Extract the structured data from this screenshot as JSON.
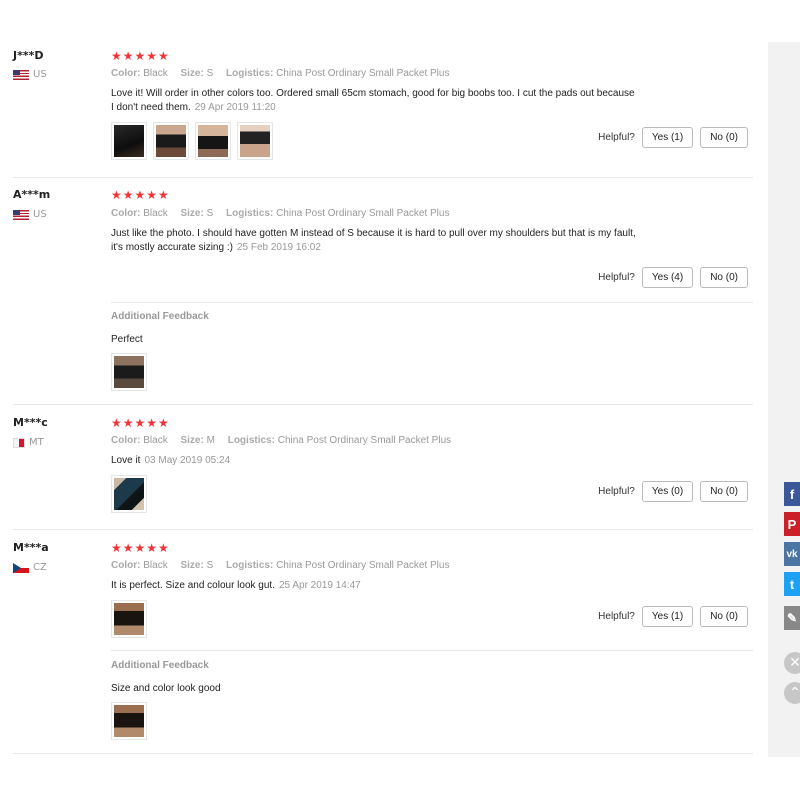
{
  "labels": {
    "color": "Color:",
    "size": "Size:",
    "logistics": "Logistics:",
    "helpful": "Helpful?",
    "additional_feedback": "Additional Feedback"
  },
  "reviews": [
    {
      "user": "J***D",
      "country": "US",
      "stars": "★★★★★",
      "color": "Black",
      "size": "S",
      "logistics": "China Post Ordinary Small Packet Plus",
      "text_line1": "Love it! Will order in other colors too. Ordered small 65cm stomach, good for big boobs too. I cut the pads out because",
      "text_line2": "I don't need them.",
      "date": "29 Apr 2019 11:20",
      "yes": "Yes (1)",
      "no": "No (0)"
    },
    {
      "user": "A***m",
      "country": "US",
      "stars": "★★★★★",
      "color": "Black",
      "size": "S",
      "logistics": "China Post Ordinary Small Packet Plus",
      "text_line1": "Just like the photo. I should have gotten M instead of S because it is hard to pull over my shoulders but that is my fault,",
      "text_line2": "it's mostly accurate sizing :)",
      "date": "25 Feb 2019 16:02",
      "yes": "Yes (4)",
      "no": "No (0)",
      "additional": "Perfect"
    },
    {
      "user": "M***c",
      "country": "MT",
      "stars": "★★★★★",
      "color": "Black",
      "size": "M",
      "logistics": "China Post Ordinary Small Packet Plus",
      "text_line1": "Love it",
      "date": "03 May 2019 05:24",
      "yes": "Yes (0)",
      "no": "No (0)"
    },
    {
      "user": "M***a",
      "country": "CZ",
      "stars": "★★★★★",
      "color": "Black",
      "size": "S",
      "logistics": "China Post Ordinary Small Packet Plus",
      "text_line1": "It is perfect. Size and colour look gut.",
      "date": "25 Apr 2019 14:47",
      "yes": "Yes (1)",
      "no": "No (0)",
      "additional": "Size and color look good"
    }
  ],
  "social": {
    "facebook": "f",
    "pinterest": "P",
    "vk": "vk",
    "twitter": "t",
    "edit": "✎",
    "close": "✕",
    "up": "⌃"
  },
  "colors": {
    "star": "#f0353a",
    "facebook": "#3b5998",
    "pinterest": "#cb2027",
    "vk": "#4c75a3",
    "twitter": "#1da1f2"
  }
}
